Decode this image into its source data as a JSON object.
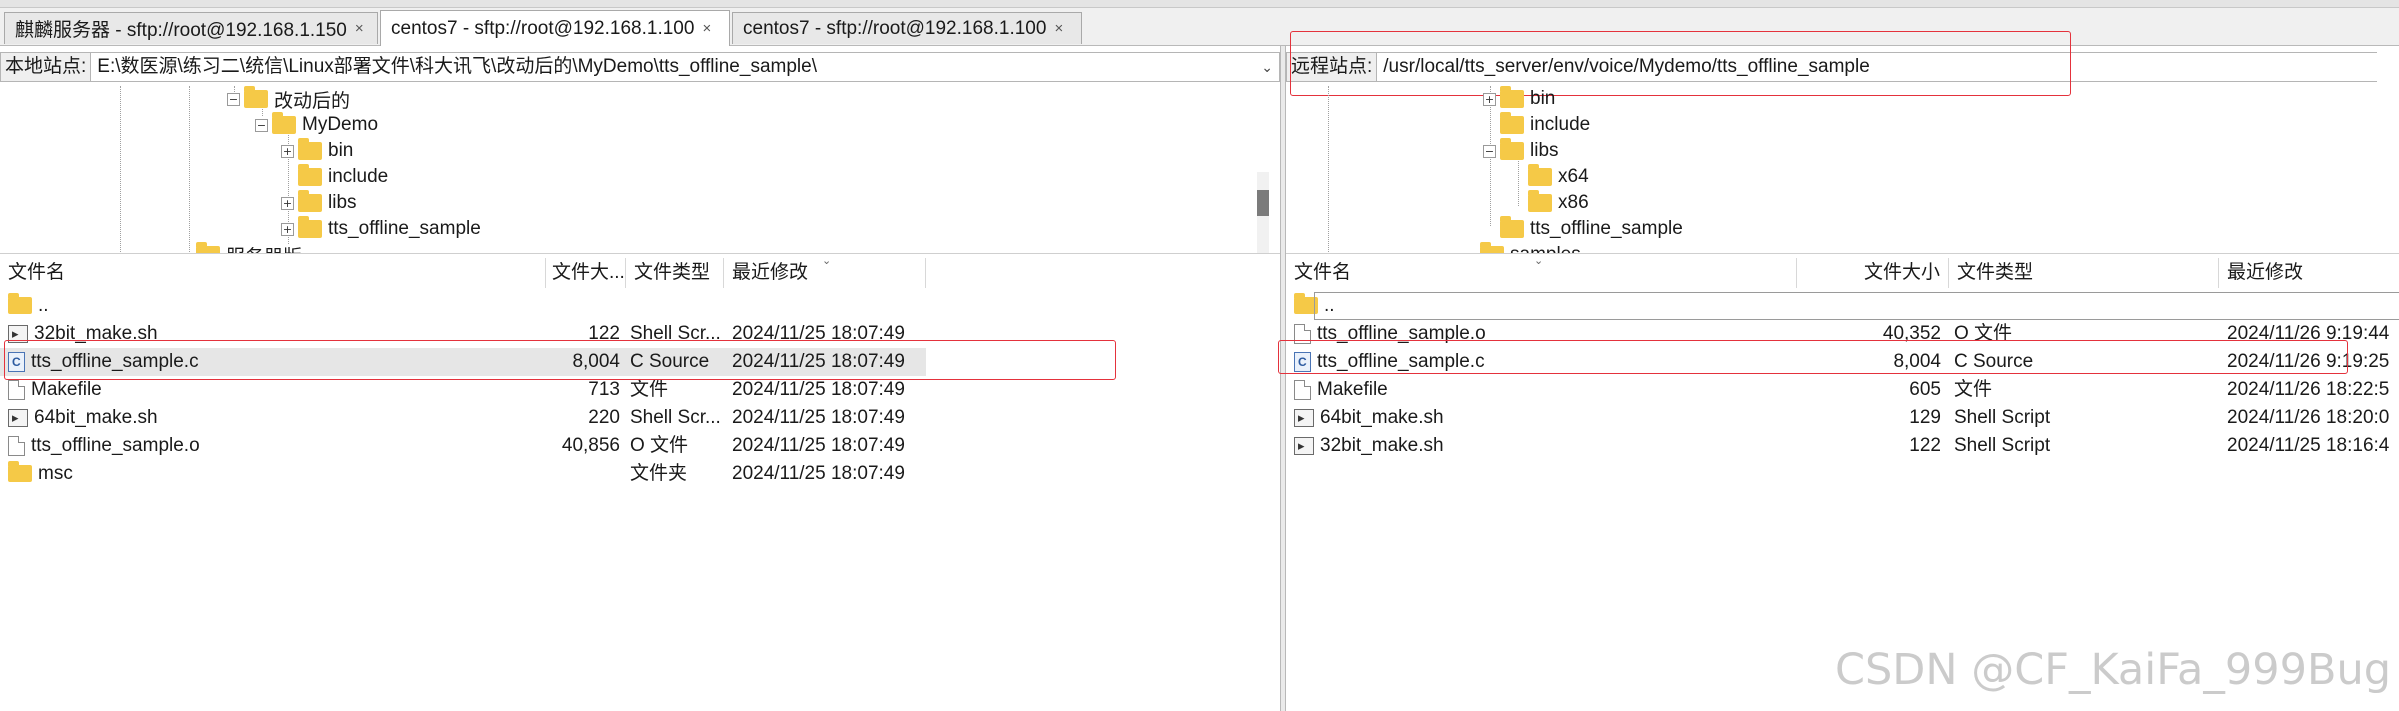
{
  "tabs": [
    {
      "label": "麒麟服务器 - sftp://root@192.168.1.150",
      "close": "×",
      "active": false
    },
    {
      "label": "centos7 - sftp://root@192.168.1.100",
      "close": "×",
      "active": true
    },
    {
      "label": "centos7 - sftp://root@192.168.1.100",
      "close": "×",
      "active": false
    }
  ],
  "local": {
    "site_label": "本地站点:",
    "path": "E:\\数医源\\练习二\\统信\\Linux部署文件\\科大讯飞\\改动后的\\MyDemo\\tts_offline_sample\\",
    "tree": [
      {
        "label": "改动后的",
        "expander": "−"
      },
      {
        "label": "MyDemo",
        "expander": "−"
      },
      {
        "label": "bin",
        "expander": "+"
      },
      {
        "label": "include",
        "expander": ""
      },
      {
        "label": "libs",
        "expander": "+"
      },
      {
        "label": "tts_offline_sample",
        "expander": "+"
      },
      {
        "label": "服务器版",
        "expander": ""
      }
    ],
    "columns": {
      "name": "文件名",
      "size": "文件大...",
      "type": "文件类型",
      "modified": "最近修改"
    },
    "files": [
      {
        "name": "..",
        "size": "",
        "type": "",
        "modified": "",
        "icon": "folder-icon"
      },
      {
        "name": "32bit_make.sh",
        "size": "122",
        "type": "Shell Scr...",
        "modified": "2024/11/25 18:07:49",
        "icon": "script-icon"
      },
      {
        "name": "tts_offline_sample.c",
        "size": "8,004",
        "type": "C Source",
        "modified": "2024/11/25 18:07:49",
        "icon": "c-source-icon"
      },
      {
        "name": "Makefile",
        "size": "713",
        "type": "文件",
        "modified": "2024/11/25 18:07:49",
        "icon": "file-icon"
      },
      {
        "name": "64bit_make.sh",
        "size": "220",
        "type": "Shell Scr...",
        "modified": "2024/11/25 18:07:49",
        "icon": "script-icon"
      },
      {
        "name": "tts_offline_sample.o",
        "size": "40,856",
        "type": "O 文件",
        "modified": "2024/11/25 18:07:49",
        "icon": "file-icon"
      },
      {
        "name": "msc",
        "size": "",
        "type": "文件夹",
        "modified": "2024/11/25 18:07:49",
        "icon": "folder-icon"
      }
    ]
  },
  "remote": {
    "site_label": "远程站点:",
    "path": "/usr/local/tts_server/env/voice/Mydemo/tts_offline_sample",
    "tree": [
      {
        "label": "bin",
        "expander": "+"
      },
      {
        "label": "include",
        "expander": ""
      },
      {
        "label": "libs",
        "expander": "−"
      },
      {
        "label": "x64",
        "expander": ""
      },
      {
        "label": "x86",
        "expander": ""
      },
      {
        "label": "tts_offline_sample",
        "expander": ""
      },
      {
        "label": "samples",
        "expander": ""
      }
    ],
    "columns": {
      "name": "文件名",
      "size": "文件大小",
      "type": "文件类型",
      "modified": "最近修改"
    },
    "files": [
      {
        "name": "..",
        "size": "",
        "type": "",
        "modified": "",
        "icon": "folder-icon"
      },
      {
        "name": "tts_offline_sample.o",
        "size": "40,352",
        "type": "O 文件",
        "modified": "2024/11/26 9:19:44",
        "icon": "file-icon"
      },
      {
        "name": "tts_offline_sample.c",
        "size": "8,004",
        "type": "C Source",
        "modified": "2024/11/26 9:19:25",
        "icon": "c-source-icon"
      },
      {
        "name": "Makefile",
        "size": "605",
        "type": "文件",
        "modified": "2024/11/26 18:22:5",
        "icon": "file-icon"
      },
      {
        "name": "64bit_make.sh",
        "size": "129",
        "type": "Shell Script",
        "modified": "2024/11/26 18:20:0",
        "icon": "script-icon"
      },
      {
        "name": "32bit_make.sh",
        "size": "122",
        "type": "Shell Script",
        "modified": "2024/11/25 18:16:4",
        "icon": "script-icon"
      }
    ]
  },
  "watermark": "CSDN @CF_KaiFa_999Bug",
  "colors": {
    "highlight_box": "#e4323c",
    "folder": "#f5c947",
    "selected_row": "#e6e6e6"
  }
}
